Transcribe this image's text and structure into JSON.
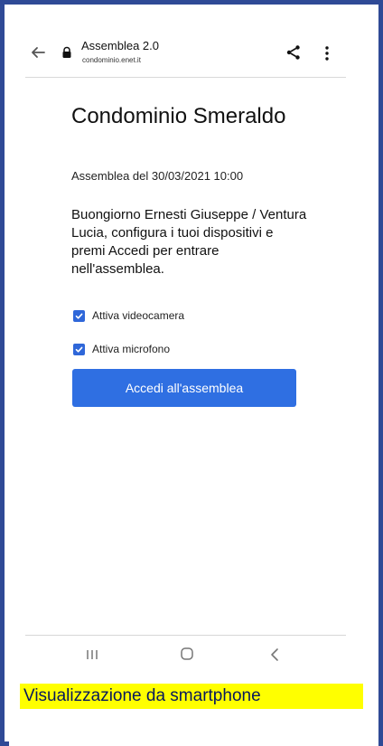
{
  "browser": {
    "title": "Assemblea 2.0",
    "url": "condominio.enet.it"
  },
  "main": {
    "title": "Condominio Smeraldo",
    "meeting_date": "Assemblea del 30/03/2021 10:00",
    "greeting": "Buongiorno Ernesti Giuseppe / Ventura Lucia, configura i tuoi dispositivi e premi Accedi per entrare nell'assemblea.",
    "options": [
      {
        "label": "Attiva videocamera",
        "checked": true
      },
      {
        "label": "Attiva microfono",
        "checked": true
      }
    ],
    "button_label": "Accedi all'assemblea"
  },
  "icons": {
    "back": "back-arrow-icon",
    "lock": "lock-icon",
    "share": "share-icon",
    "more": "more-vertical-icon",
    "recent": "recent-apps-icon",
    "home": "home-icon",
    "back_nav": "chevron-left-icon"
  },
  "colors": {
    "frame": "#2f4a96",
    "primary": "#2f6fe2",
    "checkbox": "#2f67d9",
    "caption_bg": "#ffff00",
    "caption_text": "#07185d"
  },
  "caption": "Visualizzazione da smartphone"
}
